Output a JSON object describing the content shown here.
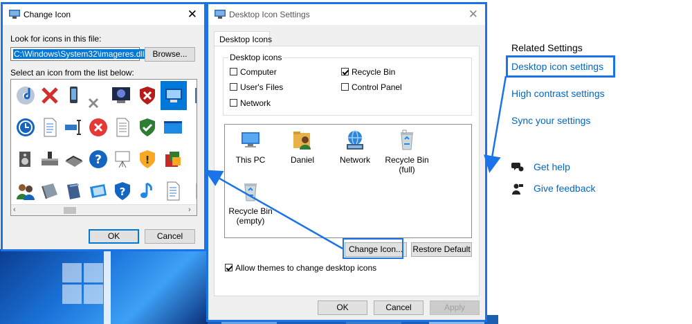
{
  "change_icon": {
    "title": "Change Icon",
    "look_label": "Look for icons in this file:",
    "file_value": "C:\\Windows\\System32\\imageres.dll",
    "browse_label": "Browse...",
    "select_label": "Select an icon from the list below:",
    "ok_label": "OK",
    "cancel_label": "Cancel"
  },
  "desktop_icon_settings": {
    "title": "Desktop Icon Settings",
    "tab_label": "Desktop Icons",
    "group_label": "Desktop icons",
    "checkboxes": [
      {
        "label": "Computer",
        "checked": false
      },
      {
        "label": "User's Files",
        "checked": false
      },
      {
        "label": "Network",
        "checked": false
      },
      {
        "label": "Recycle Bin",
        "checked": true
      },
      {
        "label": "Control Panel",
        "checked": false
      }
    ],
    "icons": [
      {
        "label": "This PC"
      },
      {
        "label": "Daniel"
      },
      {
        "label": "Network"
      },
      {
        "label": "Recycle Bin (full)"
      },
      {
        "label": "Recycle Bin (empty)"
      }
    ],
    "change_icon_label": "Change Icon...",
    "restore_default_label": "Restore Default",
    "allow_themes_label": "Allow themes to change desktop icons",
    "allow_themes_checked": true,
    "ok_label": "OK",
    "cancel_label": "Cancel",
    "apply_label": "Apply"
  },
  "related_settings": {
    "heading": "Related Settings",
    "links": [
      "Desktop icon settings",
      "High contrast settings",
      "Sync your settings"
    ],
    "get_help": "Get help",
    "give_feedback": "Give feedback"
  },
  "colors": {
    "accent": "#1a73e8",
    "link": "#0067c0",
    "dialog_bg": "#f0f0f0"
  }
}
